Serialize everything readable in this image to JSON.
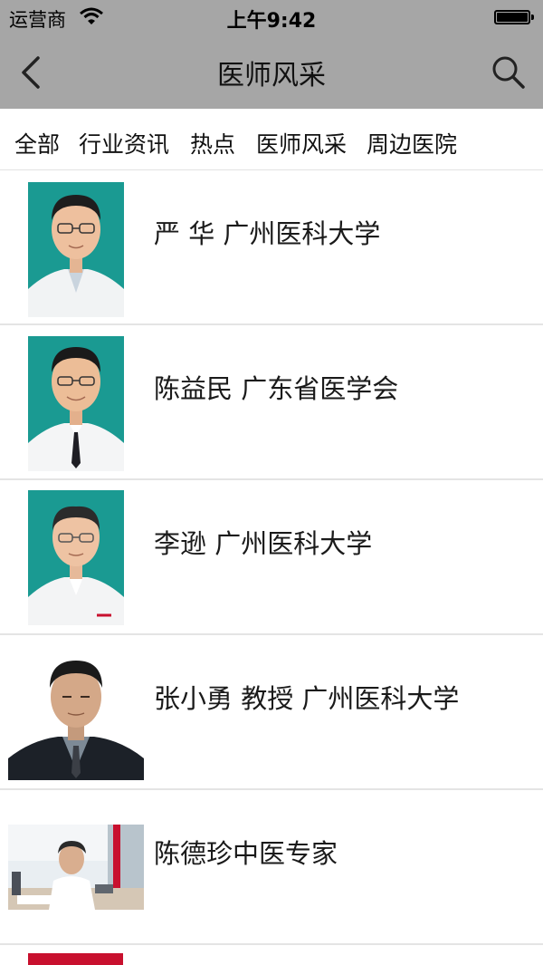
{
  "status_bar": {
    "carrier": "运营商",
    "time": "上午9:42"
  },
  "nav": {
    "title": "医师风采",
    "icons": [
      "back-chevron-icon",
      "search-icon"
    ]
  },
  "tabs": [
    {
      "label": "全部"
    },
    {
      "label": "行业资讯"
    },
    {
      "label": "热点"
    },
    {
      "label": "医师风采"
    },
    {
      "label": "周边医院"
    }
  ],
  "doctors": [
    {
      "name": "严 华 广州医科大学"
    },
    {
      "name": "陈益民 广东省医学会"
    },
    {
      "name": "李逊 广州医科大学"
    },
    {
      "name": "张小勇 教授 广州医科大学"
    },
    {
      "name": "陈德珍中医专家"
    }
  ],
  "colors": {
    "header_bg": "#a6a6a6",
    "photo_teal": "#1a9a92",
    "divider": "#e4e4e4"
  }
}
